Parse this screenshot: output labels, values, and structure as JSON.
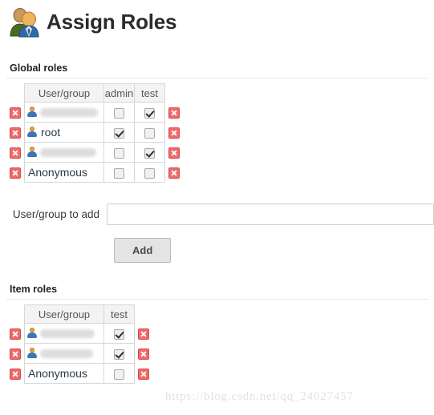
{
  "header": {
    "title": "Assign Roles",
    "icon": "two-people-icon"
  },
  "global_roles": {
    "section_title": "Global roles",
    "columns": [
      "User/group",
      "admin",
      "test"
    ],
    "rows": [
      {
        "name": "",
        "redacted": true,
        "has_user_icon": true,
        "admin": false,
        "test": true
      },
      {
        "name": "root",
        "redacted": false,
        "has_user_icon": true,
        "admin": true,
        "test": false
      },
      {
        "name": "",
        "redacted": true,
        "has_user_icon": true,
        "admin": false,
        "test": true
      },
      {
        "name": "Anonymous",
        "redacted": false,
        "has_user_icon": false,
        "admin": false,
        "test": false
      }
    ]
  },
  "add_form": {
    "label": "User/group to add",
    "value": "",
    "placeholder": "",
    "add_label": "Add"
  },
  "item_roles": {
    "section_title": "Item roles",
    "columns": [
      "User/group",
      "test"
    ],
    "rows": [
      {
        "name": "",
        "redacted": true,
        "has_user_icon": true,
        "test": true
      },
      {
        "name": "",
        "redacted": true,
        "has_user_icon": true,
        "test": true
      },
      {
        "name": "Anonymous",
        "redacted": false,
        "has_user_icon": false,
        "test": false
      }
    ]
  },
  "watermark": {
    "text": "https://blog.csdn.net/qq_24027457"
  },
  "colors": {
    "delete_button": "#ef6b6b",
    "header_bg": "#f3f3f3",
    "border": "#d7d7d7",
    "button_bg": "#e4e4e4"
  }
}
